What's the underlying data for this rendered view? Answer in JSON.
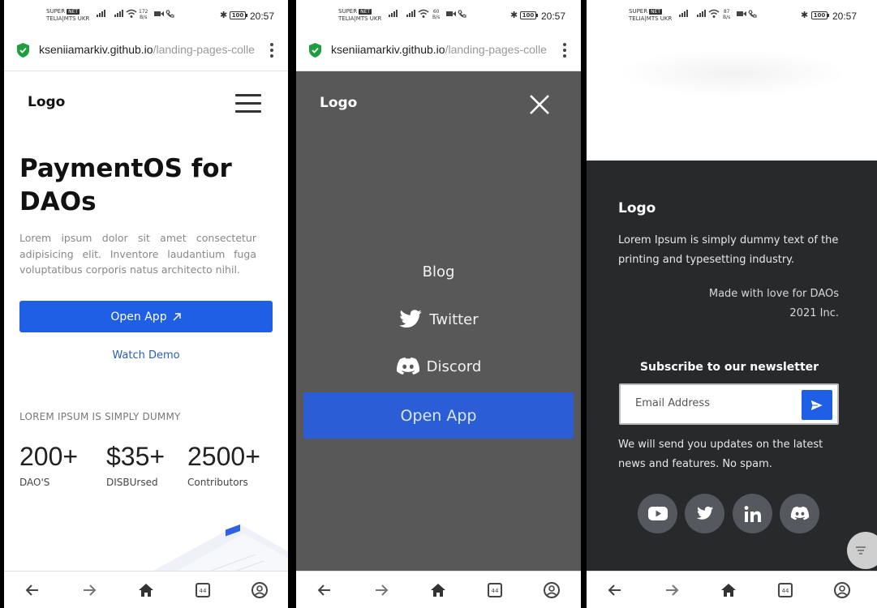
{
  "status_bar": {
    "carrier_line1": "SUPER",
    "carrier_tag": "NET",
    "carrier_line2": "TELIA|MTS UKR",
    "screens": [
      {
        "speed_value": "172",
        "speed_unit": "B/s"
      },
      {
        "speed_value": "60",
        "speed_unit": "B/s"
      },
      {
        "speed_value": "87",
        "speed_unit": "B/s"
      }
    ],
    "battery": "100",
    "time": "20:57"
  },
  "url_bar": {
    "domain": "kseniiamarkiv.github.io",
    "path": "/landing-pages-colle"
  },
  "screen1": {
    "logo": "Logo",
    "hero_title": "PaymentOS for DAOs",
    "hero_text": "Lorem ipsum dolor sit amet consectetur adipisicing elit. Inventore laudantium fuga voluptatibus corporis natus architecto nihil.",
    "open_app": "Open App",
    "watch_demo": "Watch Demo",
    "caption": "LOREM IPSUM IS SIMPLY DUMMY",
    "stats": [
      {
        "value": "200+",
        "label": "DAO'S"
      },
      {
        "value": "$35+",
        "label": "DISBUrsed"
      },
      {
        "value": "2500+",
        "label": "Contributors"
      }
    ]
  },
  "screen2": {
    "logo": "Logo",
    "menu": {
      "blog": "Blog",
      "twitter": "Twitter",
      "discord": "Discord",
      "open_app": "Open App"
    }
  },
  "screen3": {
    "logo": "Logo",
    "description": "Lorem Ipsum is simply dummy text of the printing and typesetting industry.",
    "made_line1": "Made with love for DAOs",
    "made_line2": "2021 Inc.",
    "subscribe_title": "Subscribe to our newsletter",
    "email_placeholder": "Email Address",
    "note": "We will send you updates on the latest news and features. No spam.",
    "social_icons": [
      "youtube-icon",
      "twitter-icon",
      "linkedin-icon",
      "discord-icon"
    ]
  },
  "colors": {
    "primary": "#1f5fe6",
    "menu_overlay": "#585858",
    "footer_bg": "#27292b",
    "social_bg": "#56585f"
  }
}
